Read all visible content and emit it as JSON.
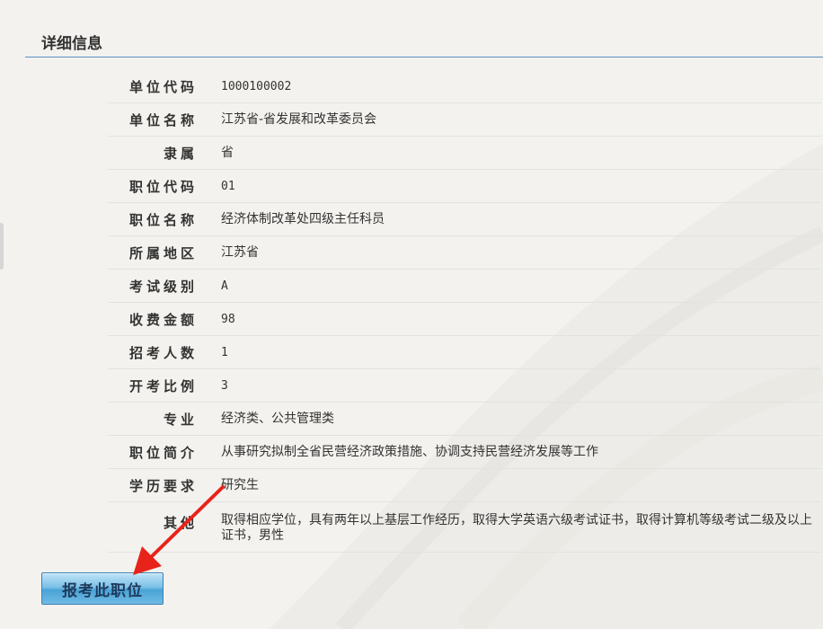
{
  "header": {
    "title": "详细信息"
  },
  "details": [
    {
      "key": "unit-code",
      "label": "单位代码",
      "value": "1000100002",
      "mono": true
    },
    {
      "key": "unit-name",
      "label": "单位名称",
      "value": "江苏省-省发展和改革委员会"
    },
    {
      "key": "affiliation",
      "label": "隶属",
      "value": "省"
    },
    {
      "key": "position-code",
      "label": "职位代码",
      "value": "01",
      "mono": true
    },
    {
      "key": "position-name",
      "label": "职位名称",
      "value": "经济体制改革处四级主任科员"
    },
    {
      "key": "region",
      "label": "所属地区",
      "value": "江苏省"
    },
    {
      "key": "exam-level",
      "label": "考试级别",
      "value": "A",
      "mono": true
    },
    {
      "key": "fee",
      "label": "收费金额",
      "value": "98",
      "mono": true
    },
    {
      "key": "recruit-count",
      "label": "招考人数",
      "value": "1",
      "mono": true
    },
    {
      "key": "exam-ratio",
      "label": "开考比例",
      "value": "3",
      "mono": true
    },
    {
      "key": "major",
      "label": "专业",
      "value": "经济类、公共管理类"
    },
    {
      "key": "position-intro",
      "label": "职位简介",
      "value": "从事研究拟制全省民营经济政策措施、协调支持民营经济发展等工作"
    },
    {
      "key": "education",
      "label": "学历要求",
      "value": "研究生"
    },
    {
      "key": "other",
      "label": "其他",
      "value": "取得相应学位，具有两年以上基层工作经历，取得大学英语六级考试证书，取得计算机等级考试二级及以上证书，男性",
      "tall": true
    }
  ],
  "actions": {
    "apply_label": "报考此职位"
  },
  "colors": {
    "header_rule": "#5b8fc0",
    "arrow": "#e8231a",
    "button": "#4aa3d6"
  }
}
